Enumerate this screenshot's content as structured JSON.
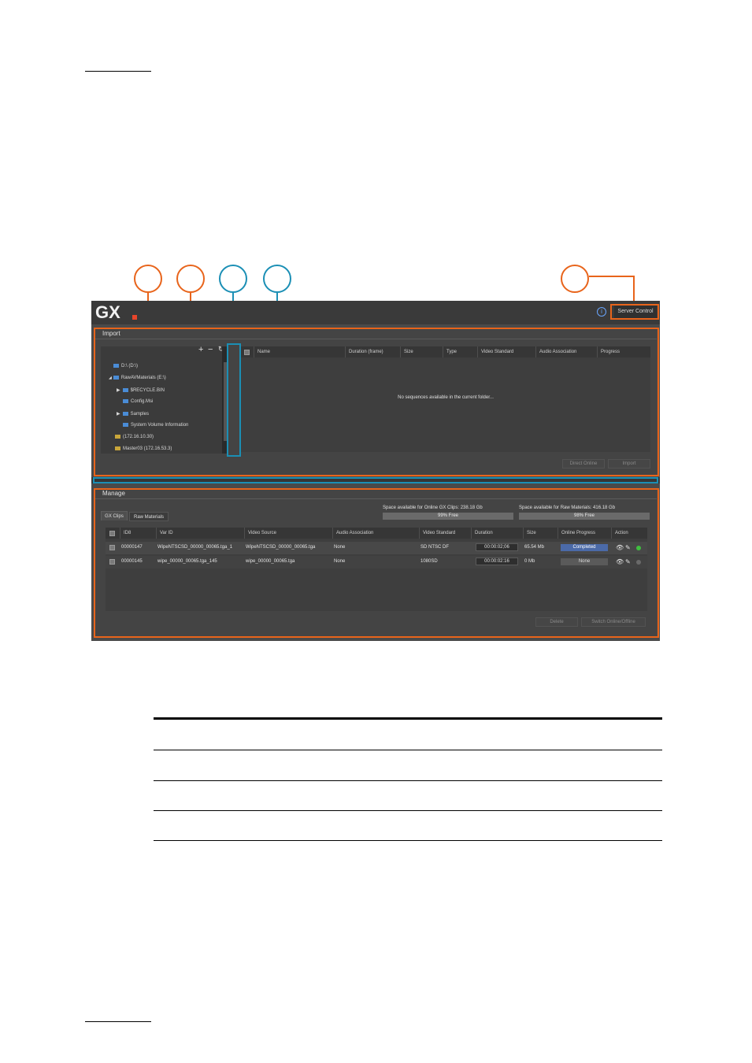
{
  "app": {
    "logo": "GX",
    "server_control": "Server Control",
    "info": "i"
  },
  "import": {
    "title": "Import",
    "toolbar": {
      "add": "+",
      "remove": "−",
      "refresh": "↻"
    },
    "tree": [
      {
        "label": "D:\\  (D:\\)",
        "kind": "drive"
      },
      {
        "label": "RawAVMaterials  (E:\\)",
        "kind": "drive"
      },
      {
        "label": "$RECYCLE.BIN",
        "kind": "folder"
      },
      {
        "label": "Config.Msi",
        "kind": "folder"
      },
      {
        "label": "Samples",
        "kind": "folder"
      },
      {
        "label": "System Volume Information",
        "kind": "folder"
      },
      {
        "label": "(172.16.10.30)",
        "kind": "server"
      },
      {
        "label": "Master03  (172.16.53.3)",
        "kind": "server"
      }
    ],
    "columns": [
      "Name",
      "Duration (frame)",
      "Size",
      "Type",
      "Video Standard",
      "Audio Association",
      "Progress"
    ],
    "empty_message": "No sequences available in the current folder...",
    "buttons": {
      "direct_online": "Direct Online",
      "import": "Import"
    }
  },
  "manage": {
    "title": "Manage",
    "tabs": [
      "GX Clips",
      "Raw Materials"
    ],
    "space_online_label": "Space available for Online GX Clips: 238.18 Gb",
    "space_online_free": "99% Free",
    "space_raw_label": "Space available for Raw Materials: 416.18 Gb",
    "space_raw_free": "98% Free",
    "columns": [
      "ID8",
      "Var ID",
      "Video Source",
      "Audio Association",
      "Video Standard",
      "Duration",
      "Size",
      "Online Progress",
      "Action"
    ],
    "rows": [
      {
        "id8": "00000147",
        "var_id": "WipeNTSCSD_00000_00065.tga_1",
        "video_source": "WipeNTSCSD_00000_00065.tga",
        "audio": "None",
        "standard": "SD NTSC DF",
        "duration": "00:00:02;06",
        "size": "65.54 Mb",
        "progress": "Completed",
        "status_color": "#3fbf3f"
      },
      {
        "id8": "00000145",
        "var_id": "wipe_00000_00065.tga_145",
        "video_source": "wipe_00000_00065.tga",
        "audio": "None",
        "standard": "1080SD",
        "duration": "00:00:02:16",
        "size": "0 Mb",
        "progress": "None",
        "status_color": "#6a6a6a"
      }
    ],
    "buttons": {
      "delete": "Delete",
      "switch": "Switch Online/Offline"
    }
  },
  "colors": {
    "orange": "#e8641b",
    "blue": "#1b8fb5"
  }
}
